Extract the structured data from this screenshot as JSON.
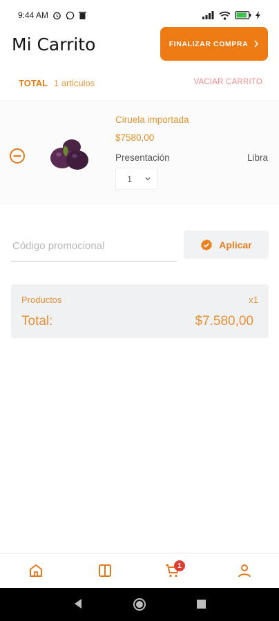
{
  "status_bar": {
    "time": "9:44 AM",
    "battery_level": 0.85
  },
  "header": {
    "title": "Mi Carrito",
    "checkout_label": "FINALIZAR COMPRA",
    "checkout_icon": "chevron-right-icon"
  },
  "summary": {
    "total_label": "TOTAL",
    "item_count_text": "1 articulos",
    "empty_cart_label": "VACIAR CARRITO"
  },
  "cart_items": [
    {
      "name": "Ciruela importada",
      "price": "$7580,00",
      "presentation_label": "Presentación",
      "presentation_value": "Libra",
      "quantity": "1",
      "image": "plum-image",
      "remove_icon": "minus-circle-icon"
    }
  ],
  "promo": {
    "placeholder": "Código promocional",
    "apply_label": "Aplicar",
    "apply_icon": "verified-check-icon"
  },
  "totals": {
    "products_label": "Productos",
    "products_count": "x1",
    "total_label": "Total:",
    "total_amount": "$7.580,00"
  },
  "bottom_nav": {
    "items": [
      {
        "name": "home",
        "icon": "home-icon"
      },
      {
        "name": "catalog",
        "icon": "book-icon"
      },
      {
        "name": "cart",
        "icon": "cart-icon",
        "badge": "1"
      },
      {
        "name": "profile",
        "icon": "user-icon"
      }
    ]
  },
  "colors": {
    "accent": "#ee7a13",
    "accent_text": "#e3962f",
    "danger": "#e13d37",
    "empty_cart": "#ec8c8c",
    "panel": "#f0f1f3"
  }
}
